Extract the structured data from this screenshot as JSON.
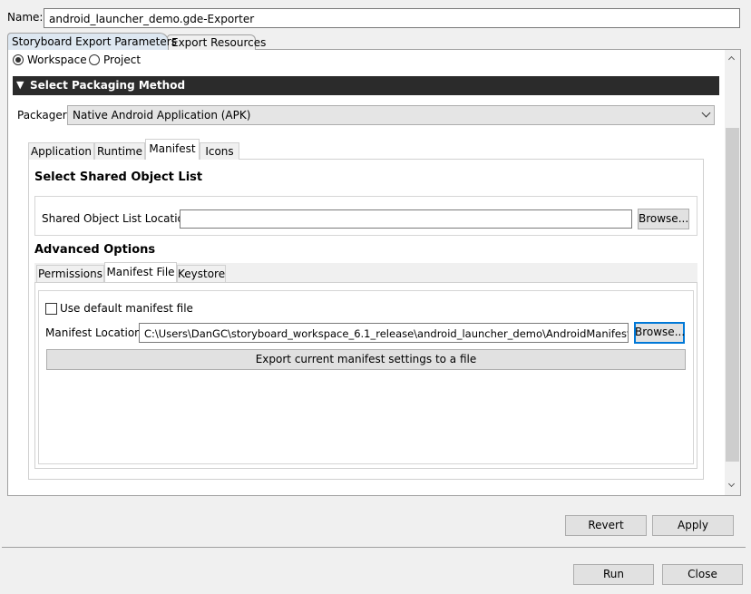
{
  "name_field": {
    "label": "Name:",
    "value": "android_launcher_demo.gde-Exporter"
  },
  "top_tabs": [
    {
      "label": "Storyboard Export Parameters",
      "active": true
    },
    {
      "label": "Export Resources",
      "active": false
    }
  ],
  "scope": {
    "options": [
      "Workspace",
      "Project"
    ],
    "selected": "Workspace"
  },
  "packaging_section": {
    "title": "Select Packaging Method"
  },
  "packager": {
    "label": "Packager:",
    "value": "Native Android Application (APK)"
  },
  "inner_tabs": [
    {
      "label": "Application",
      "active": false
    },
    {
      "label": "Runtime",
      "active": false
    },
    {
      "label": "Manifest",
      "active": true
    },
    {
      "label": "Icons",
      "active": false
    }
  ],
  "shared_object": {
    "heading": "Select Shared Object List",
    "location_label": "Shared Object List Location:",
    "location_value": "",
    "browse_label": "Browse..."
  },
  "advanced": {
    "heading": "Advanced Options",
    "tabs": [
      {
        "label": "Permissions",
        "active": false
      },
      {
        "label": "Manifest File",
        "active": true
      },
      {
        "label": "Keystore",
        "active": false
      }
    ],
    "use_default_label": "Use default manifest file",
    "use_default_checked": false,
    "manifest_location_label": "Manifest Location:",
    "manifest_location_value": "C:\\Users\\DanGC\\storyboard_workspace_6.1_release\\android_launcher_demo\\AndroidManifest-test.x",
    "browse_label": "Browse...",
    "export_button_label": "Export current manifest settings to a file"
  },
  "bottom_buttons": {
    "revert": "Revert",
    "apply": "Apply"
  },
  "dialog_buttons": {
    "run": "Run",
    "close": "Close"
  },
  "colors": {
    "section_header_bg": "#2b2b2b",
    "focus_accent": "#0078d7"
  }
}
